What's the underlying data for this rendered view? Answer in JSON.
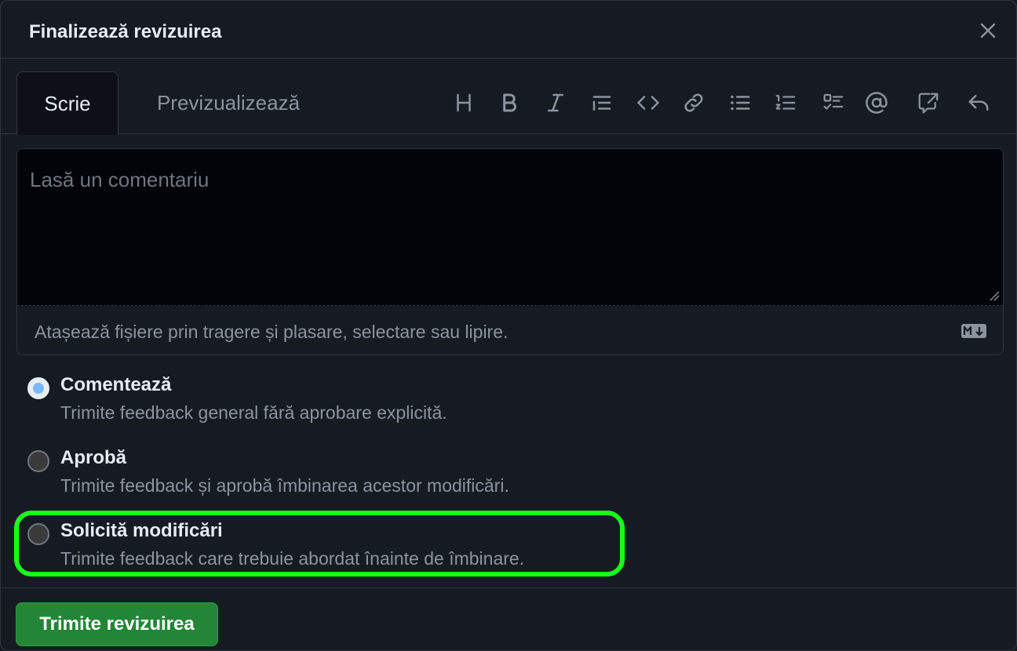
{
  "dialog": {
    "title": "Finalizează revizuirea",
    "close_icon": "close-icon"
  },
  "tabs": [
    {
      "label": "Scrie",
      "active": true
    },
    {
      "label": "Previzualizează",
      "active": false
    }
  ],
  "toolbar": {
    "icons": [
      "heading-icon",
      "bold-icon",
      "italic-icon",
      "quote-icon",
      "code-icon",
      "link-icon",
      "unordered-list-icon",
      "ordered-list-icon",
      "task-list-icon",
      "mention-icon",
      "reference-icon",
      "reply-icon"
    ]
  },
  "editor": {
    "placeholder": "Lasă un comentariu",
    "value": "",
    "attach_text": "Atașează fișiere prin tragere și plasare, selectare sau lipire.",
    "markdown_icon": "markdown-icon"
  },
  "review_options": [
    {
      "title": "Comentează",
      "description": "Trimite feedback general fără aprobare explicită.",
      "checked": true
    },
    {
      "title": "Aprobă",
      "description": "Trimite feedback și aprobă îmbinarea acestor modificări.",
      "checked": false
    },
    {
      "title": "Solicită modificări",
      "description": "Trimite feedback care trebuie abordat înainte de îmbinare.",
      "checked": false
    }
  ],
  "footer": {
    "submit_label": "Trimite revizuirea"
  },
  "colors": {
    "background": "#161b22",
    "editor_bg": "#010409",
    "border": "#30363d",
    "text": "#e6edf3",
    "muted": "#8b949e",
    "radio_selected": "#4493f8",
    "submit_green": "#238636",
    "highlight": "#1aff1a"
  }
}
